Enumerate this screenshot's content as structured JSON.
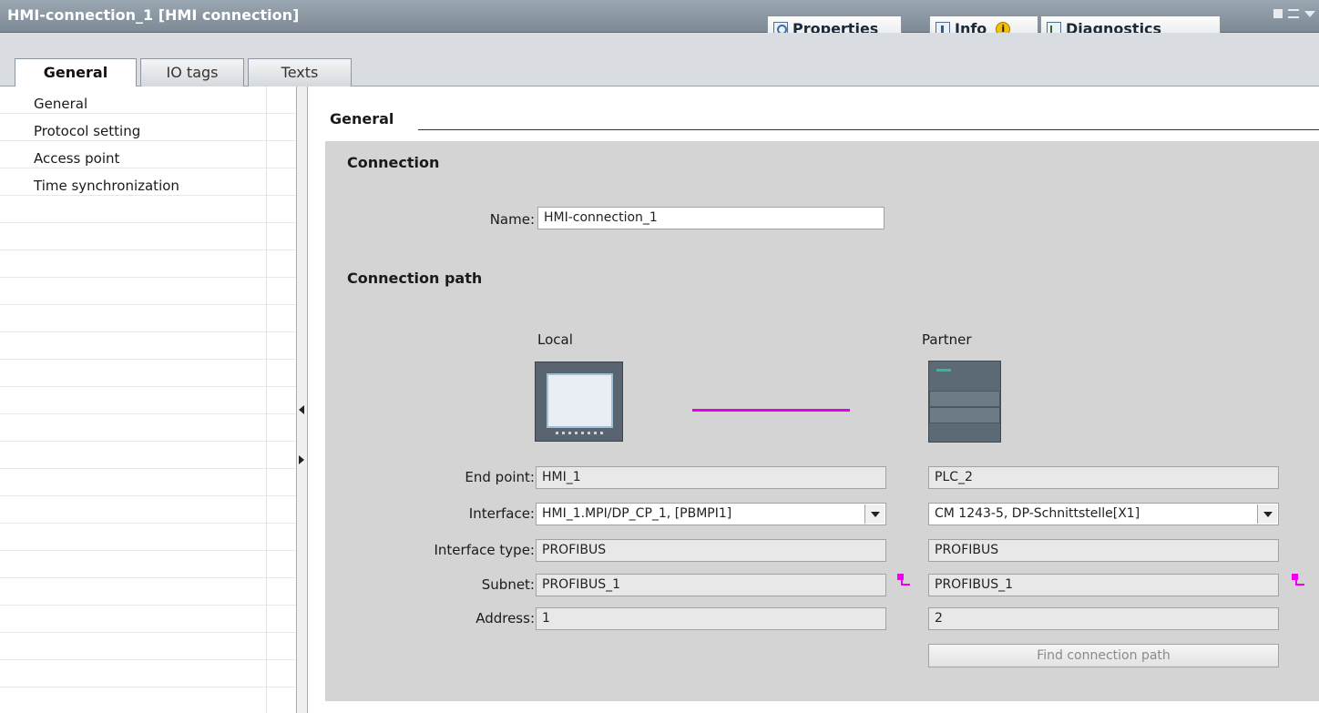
{
  "titlebar": {
    "title": "HMI-connection_1 [HMI connection]",
    "tabs": [
      {
        "label": "Properties",
        "icon": "properties-icon"
      },
      {
        "label": "Info",
        "icon": "info-icon",
        "badge": "i"
      },
      {
        "label": "Diagnostics",
        "icon": "diagnostics-icon"
      }
    ]
  },
  "tabs": [
    "General",
    "IO tags",
    "Texts"
  ],
  "nav": {
    "items": [
      "General",
      "Protocol setting",
      "Access point",
      "Time synchronization"
    ]
  },
  "main": {
    "section_title": "General",
    "connection": {
      "title": "Connection",
      "name_label": "Name:",
      "name_value": "HMI-connection_1"
    },
    "path": {
      "title": "Connection path",
      "local_label": "Local",
      "partner_label": "Partner",
      "labels": {
        "endpoint": "End point:",
        "interface": "Interface:",
        "interface_type": "Interface type:",
        "subnet": "Subnet:",
        "address": "Address:"
      },
      "local": {
        "endpoint": "HMI_1",
        "interface": "HMI_1.MPI/DP_CP_1, [PBMPI1]",
        "interface_type": "PROFIBUS",
        "subnet": "PROFIBUS_1",
        "address": "1"
      },
      "partner": {
        "endpoint": "PLC_2",
        "interface": "CM 1243-5, DP-Schnittstelle[X1]",
        "interface_type": "PROFIBUS",
        "subnet": "PROFIBUS_1",
        "address": "2"
      },
      "find_button": "Find connection path"
    }
  },
  "colors": {
    "titlebar": "#8a96a1",
    "panel": "#d4d4d4",
    "connection_line": "#e600e6"
  }
}
